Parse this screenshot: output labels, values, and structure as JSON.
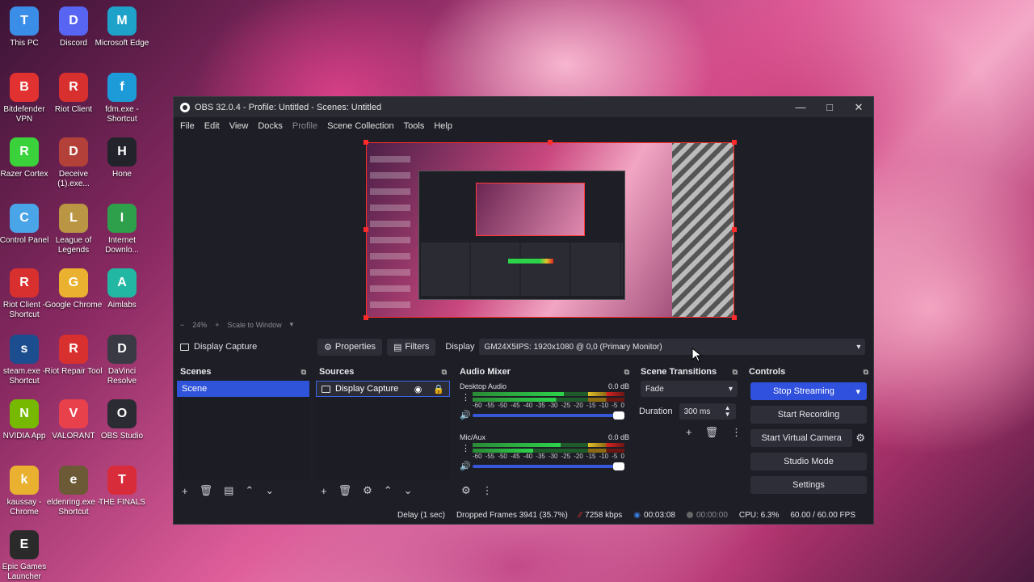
{
  "desktop": {
    "icons": [
      {
        "label": "This PC",
        "icon": "computer-icon",
        "color": "#3b8ee8"
      },
      {
        "label": "Discord",
        "icon": "discord-icon",
        "color": "#5865f2"
      },
      {
        "label": "Microsoft Edge",
        "icon": "edge-icon",
        "color": "#1ea2c9"
      },
      {
        "label": "Bitdefender VPN",
        "icon": "bitdefender-icon",
        "color": "#e23131"
      },
      {
        "label": "Riot Client",
        "icon": "riot-icon",
        "color": "#d8302f"
      },
      {
        "label": "fdm.exe - Shortcut",
        "icon": "fdm-icon",
        "color": "#1c9bd8"
      },
      {
        "label": "Razer Cortex",
        "icon": "razer-icon",
        "color": "#3ad13a"
      },
      {
        "label": "Deceive (1).exe...",
        "icon": "deceive-icon",
        "color": "#b4403a"
      },
      {
        "label": "Hone",
        "icon": "hone-icon",
        "color": "#23232b"
      },
      {
        "label": "Control Panel",
        "icon": "control-panel-icon",
        "color": "#4aa4e8"
      },
      {
        "label": "League of Legends",
        "icon": "league-icon",
        "color": "#b99544"
      },
      {
        "label": "Internet Downlo...",
        "icon": "idm-icon",
        "color": "#2e9f4a"
      },
      {
        "label": "Riot Client - Shortcut",
        "icon": "riot-icon",
        "color": "#d8302f"
      },
      {
        "label": "Google Chrome",
        "icon": "chrome-icon",
        "color": "#e9b12f"
      },
      {
        "label": "Aimlabs",
        "icon": "aimlabs-icon",
        "color": "#21b7a3"
      },
      {
        "label": "steam.exe - Shortcut",
        "icon": "steam-icon",
        "color": "#1b4d8f"
      },
      {
        "label": "Riot Repair Tool",
        "icon": "riot-icon",
        "color": "#d8302f"
      },
      {
        "label": "DaVinci Resolve",
        "icon": "davinci-icon",
        "color": "#3a3a44"
      },
      {
        "label": "NVIDIA App",
        "icon": "nvidia-icon",
        "color": "#76b900"
      },
      {
        "label": "VALORANT",
        "icon": "valorant-icon",
        "color": "#e8414b"
      },
      {
        "label": "OBS Studio",
        "icon": "obs-icon",
        "color": "#2b2b33"
      },
      {
        "label": "kaussay - Chrome",
        "icon": "chrome-icon",
        "color": "#e9b12f"
      },
      {
        "label": "eldenring.exe - Shortcut",
        "icon": "eldenring-icon",
        "color": "#6b5a35"
      },
      {
        "label": "THE FINALS",
        "icon": "thefinals-icon",
        "color": "#d82c3a"
      },
      {
        "label": "Epic Games Launcher",
        "icon": "epic-icon",
        "color": "#2a2a2a"
      }
    ]
  },
  "window": {
    "title": "OBS 32.0.4 - Profile: Untitled - Scenes: Untitled",
    "menu": [
      "File",
      "Edit",
      "View",
      "Docks",
      "Profile",
      "Scene Collection",
      "Tools",
      "Help"
    ]
  },
  "preview": {
    "zoom": "24%",
    "scale_mode": "Scale to Window"
  },
  "source_bar": {
    "source_name": "Display Capture",
    "properties": "Properties",
    "filters": "Filters",
    "display_label": "Display",
    "display_value": "GM24X5IPS: 1920x1080 @ 0,0 (Primary Monitor)"
  },
  "scenes": {
    "title": "Scenes",
    "items": [
      "Scene"
    ]
  },
  "sources": {
    "title": "Sources",
    "items": [
      "Display Capture"
    ]
  },
  "mixer": {
    "title": "Audio Mixer",
    "channels": [
      {
        "name": "Desktop Audio",
        "db": "0.0 dB"
      },
      {
        "name": "Mic/Aux",
        "db": "0.0 dB"
      }
    ],
    "scale": [
      "-60",
      "-55",
      "-50",
      "-45",
      "-40",
      "-35",
      "-30",
      "-25",
      "-20",
      "-15",
      "-10",
      "-5",
      "0"
    ]
  },
  "transitions": {
    "title": "Scene Transitions",
    "selected": "Fade",
    "duration_label": "Duration",
    "duration_value": "300 ms"
  },
  "controls": {
    "title": "Controls",
    "stop_streaming": "Stop Streaming",
    "start_recording": "Start Recording",
    "start_virtual_camera": "Start Virtual Camera",
    "studio_mode": "Studio Mode",
    "settings": "Settings"
  },
  "status": {
    "delay": "Delay (1 sec)",
    "dropped_frames": "Dropped Frames 3941 (35.7%)",
    "bitrate": "7258 kbps",
    "stream_time": "00:03:08",
    "record_time": "00:00:00",
    "cpu": "CPU: 6.3%",
    "fps": "60.00 / 60.00 FPS"
  }
}
